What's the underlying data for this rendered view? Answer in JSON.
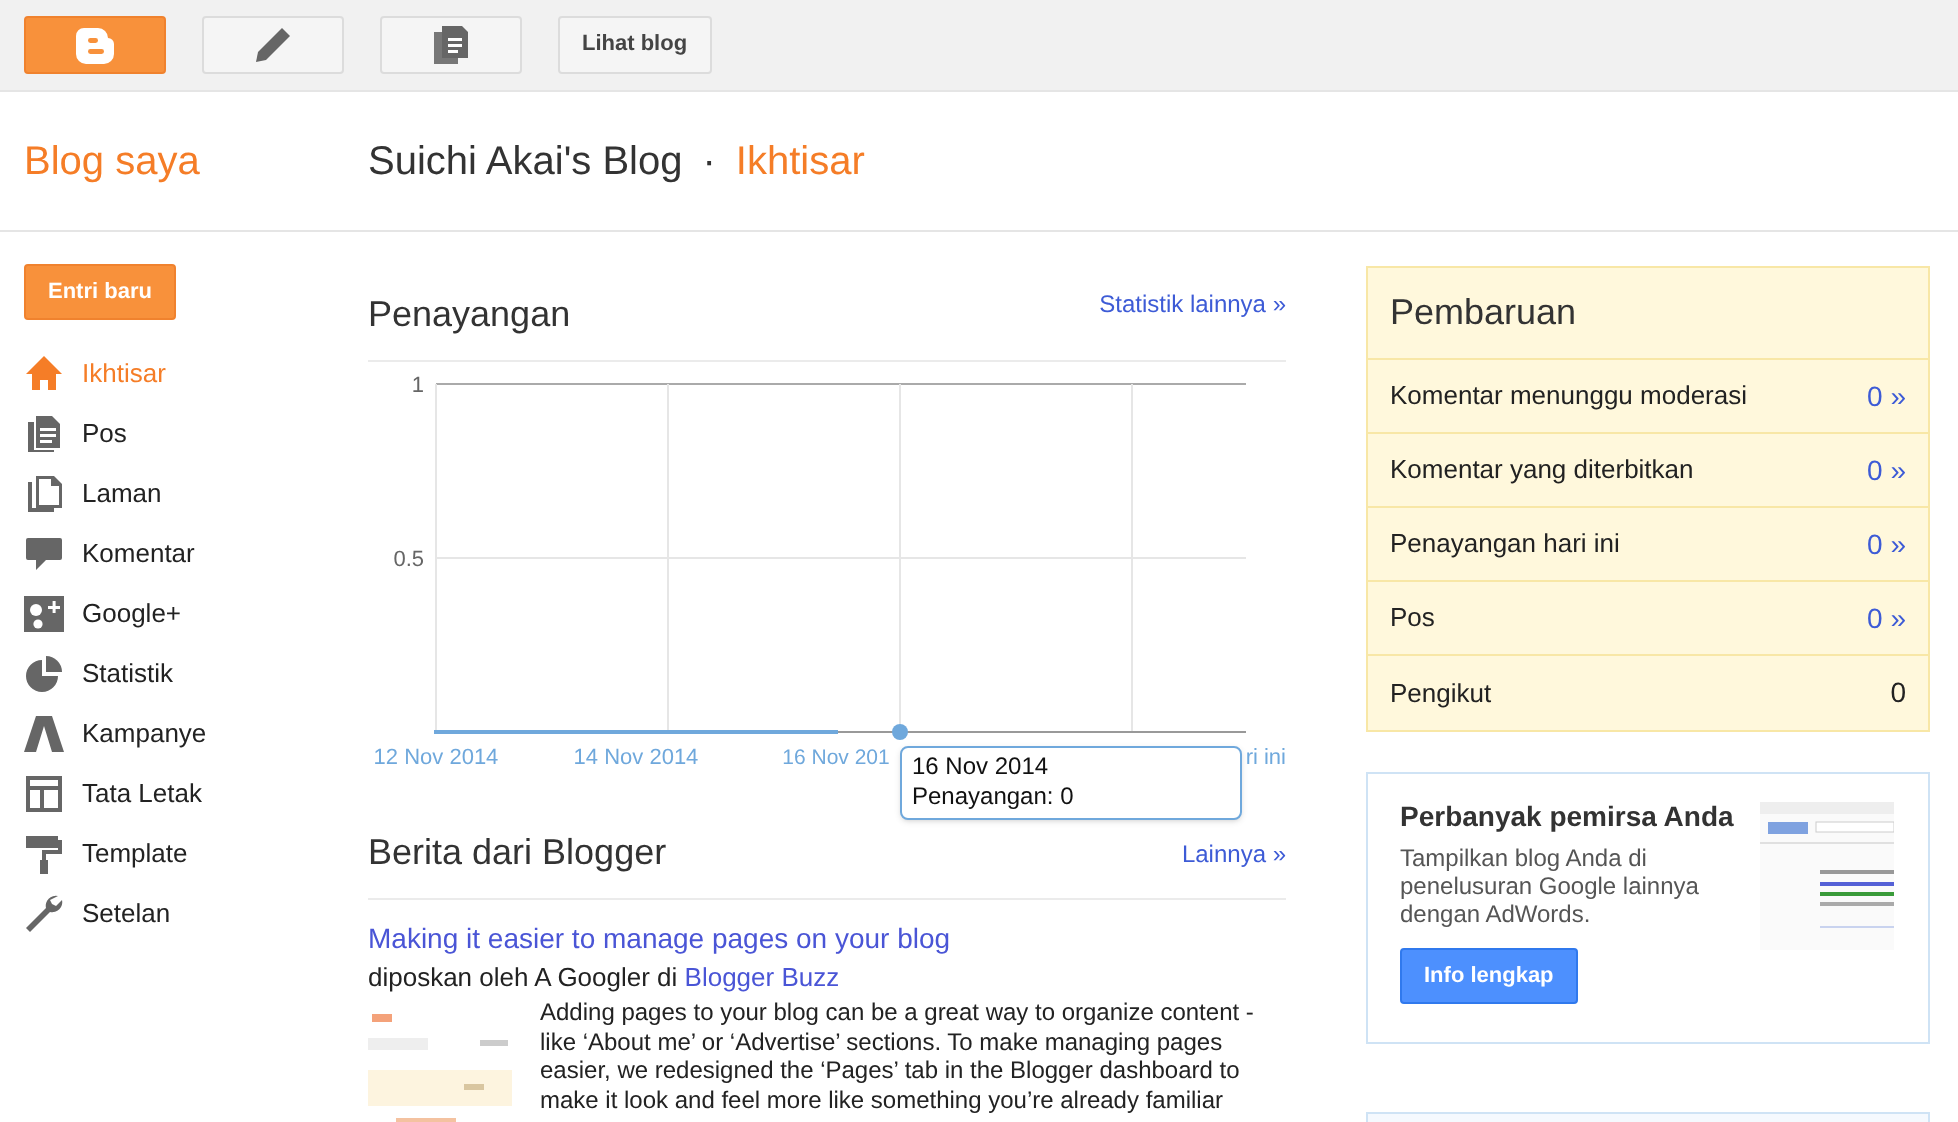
{
  "topbar": {
    "buttons": [
      {
        "kind": "logo"
      },
      {
        "kind": "pencil"
      },
      {
        "kind": "pages"
      },
      {
        "kind": "text",
        "label": "Lihat blog"
      }
    ]
  },
  "header": {
    "home_link": "Blog saya",
    "blog_title": "Suichi Akai's Blog",
    "separator": "·",
    "page": "Ikhtisar"
  },
  "sidebar": {
    "new_post_button": "Entri baru",
    "items": [
      {
        "label": "Ikhtisar",
        "selected": true
      },
      {
        "label": "Pos",
        "selected": false
      },
      {
        "label": "Laman",
        "selected": false
      },
      {
        "label": "Komentar",
        "selected": false
      },
      {
        "label": "Google+",
        "selected": false
      },
      {
        "label": "Statistik",
        "selected": false
      },
      {
        "label": "Kampanye",
        "selected": false
      },
      {
        "label": "Tata Letak",
        "selected": false
      },
      {
        "label": "Template",
        "selected": false
      },
      {
        "label": "Setelan",
        "selected": false
      }
    ]
  },
  "views": {
    "title": "Penayangan",
    "more_link": "Statistik lainnya »",
    "chart_data": {
      "type": "line",
      "categories": [
        "12 Nov 2014",
        "14 Nov 2014",
        "16 Nov 201"
      ],
      "series": [
        {
          "color": "#6fa8dc",
          "values": [
            0,
            0,
            0
          ]
        }
      ],
      "ylim": [
        0,
        1
      ],
      "yticks": [
        0.5,
        1
      ]
    },
    "axis_end_label": "ri ini",
    "tooltip": {
      "date": "16 Nov 2014",
      "text": "Penayangan: 0"
    }
  },
  "news": {
    "title": "Berita dari Blogger",
    "more_link": "Lainnya »",
    "post": {
      "title": "Making it easier to manage pages on your blog",
      "byline": "diposkan oleh A Googler di",
      "source": "Blogger Buzz",
      "excerpt": "Adding pages to your blog can be a great way to organize content - like ‘About me’ or ‘Advertise’ sections. To make managing pages easier, we redesigned the ‘Pages’ tab in the Blogger dashboard to make it look and feel more like something you’re already familiar"
    }
  },
  "updates": {
    "title": "Pembaruan",
    "rows": [
      {
        "label": "Komentar menunggu moderasi",
        "value": "0 »",
        "kind": "link"
      },
      {
        "label": "Komentar yang diterbitkan",
        "value": "0 »",
        "kind": "link"
      },
      {
        "label": "Penayangan hari ini",
        "value": "0 »",
        "kind": "link"
      },
      {
        "label": "Pos",
        "value": "0 »",
        "kind": "link"
      },
      {
        "label": "Pengikut",
        "value": "0",
        "kind": "plain"
      }
    ]
  },
  "promo": {
    "title": "Perbanyak pemirsa Anda",
    "text": "Tampilkan blog Anda di penelusuran Google lainnya dengan AdWords.",
    "button": "Info lengkap"
  }
}
